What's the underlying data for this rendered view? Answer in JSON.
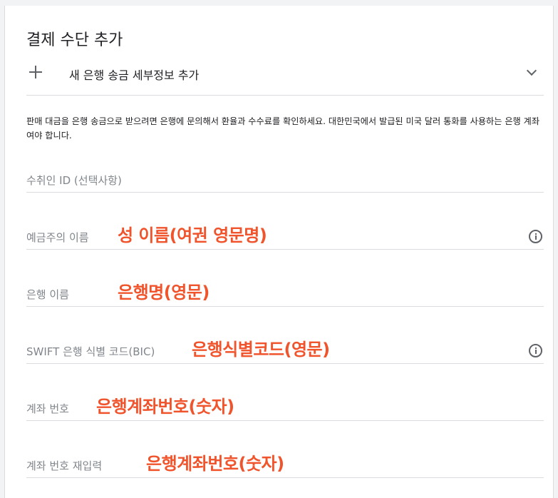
{
  "section": {
    "title": "결제 수단 추가"
  },
  "add_bank": {
    "label": "새 은행 송금 세부정보 추가",
    "icon": "plus-icon",
    "expand_icon": "chevron-down-icon"
  },
  "description": "판매 대금을 은행 송금으로 받으려면 은행에 문의해서 환율과 수수료를 확인하세요. 대한민국에서 발급된 미국 달러 통화를 사용하는 은행 계좌여야 합니다.",
  "fields": {
    "payee_id": {
      "label": "수취인 ID (선택사항)"
    },
    "account_holder": {
      "label": "예금주의 이름",
      "annotation": "성 이름(여권 영문명)"
    },
    "bank_name": {
      "label": "은행 이름",
      "annotation": "은행명(영문)"
    },
    "swift": {
      "label": "SWIFT 은행 식별 코드(BIC)",
      "annotation": "은행식별코드(영문)"
    },
    "account_number": {
      "label": "계좌 번호",
      "annotation": "은행계좌번호(숫자)"
    },
    "account_number_confirm": {
      "label": "계좌 번호 재입력",
      "annotation": "은행계좌번호(숫자)"
    }
  },
  "colors": {
    "annotation": "#f0542c",
    "label": "#80868b",
    "divider": "#dadce0"
  }
}
